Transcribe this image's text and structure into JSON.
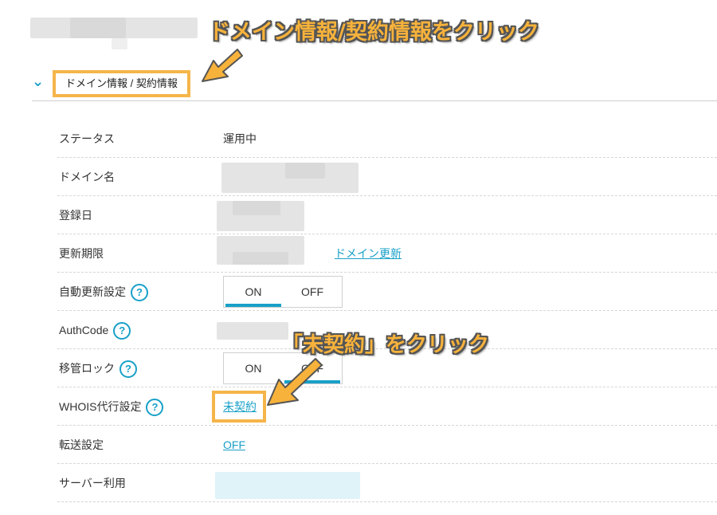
{
  "header": {
    "callout_top": "ドメイン情報/契約情報をクリック",
    "section_title": "ドメイン情報 / 契約情報"
  },
  "rows": [
    {
      "label": "ステータス",
      "value": "運用中"
    },
    {
      "label": "ドメイン名"
    },
    {
      "label": "登録日"
    },
    {
      "label": "更新期限",
      "link": "ドメイン更新"
    },
    {
      "label": "自動更新設定",
      "on": "ON",
      "off": "OFF"
    },
    {
      "label": "AuthCode"
    },
    {
      "label": "移管ロック",
      "on": "ON",
      "off": "OFF"
    },
    {
      "label": "WHOIS代行設定",
      "link": "未契約"
    },
    {
      "label": "転送設定",
      "link": "OFF"
    },
    {
      "label": "サーバー利用"
    }
  ],
  "help_glyph": "?",
  "chevron_glyph": "⌄",
  "callout_whois": "「未契約」をクリック",
  "colors": {
    "accent": "#18a0c8",
    "highlight": "#f5b54a",
    "callout_fill": "#f7b23b"
  }
}
